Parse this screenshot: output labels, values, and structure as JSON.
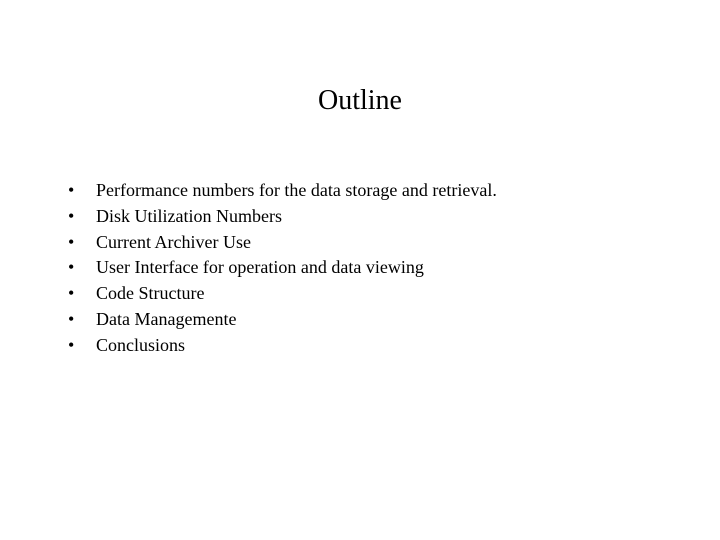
{
  "title": "Outline",
  "bullets": [
    {
      "marker": "•",
      "text": "Performance numbers for the data storage and retrieval."
    },
    {
      "marker": "•",
      "text": "Disk Utilization Numbers"
    },
    {
      "marker": "•",
      "text": "Current Archiver Use"
    },
    {
      "marker": "•",
      "text": "User Interface for operation and data viewing"
    },
    {
      "marker": "•",
      "text": "Code Structure"
    },
    {
      "marker": "•",
      "text": "Data Managemente"
    },
    {
      "marker": "•",
      "text": "Conclusions"
    }
  ]
}
